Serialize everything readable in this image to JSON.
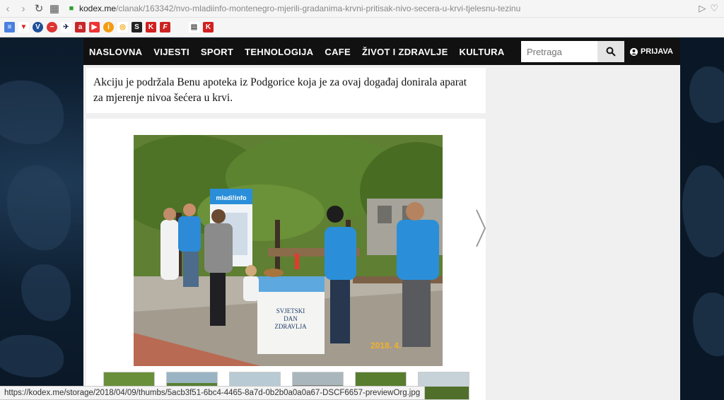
{
  "browser": {
    "url_host": "kodex.me",
    "url_path": "/clanak/163342/nvo-mladiinfo-montenegro-mjerili-gradanima-krvni-pritisak-nivo-secera-u-krvi-tjelesnu-tezinu",
    "status_url": "https://kodex.me/storage/2018/04/09/thumbs/5acb3f51-6bc4-4465-8a7d-0b2b0a0a0a67-DSCF6657-previewOrg.jpg"
  },
  "nav": {
    "items": [
      "NASLOVNA",
      "VIJESTI",
      "SPORT",
      "TEHNOLOGIJA",
      "CAFE",
      "ŽIVOT I ZDRAVLJE",
      "KULTURA"
    ],
    "search_placeholder": "Pretraga",
    "login_label": "PRIJAVA"
  },
  "article": {
    "paragraph": "Akciju je podržala Benu apoteka iz Podgorice koja je za ovaj događaj donirala aparat za mjerenje nivoa šećera u krvi."
  },
  "photo": {
    "date_stamp": "2018. 4.",
    "banner_text": "mladi!info",
    "booth_text_1": "SVJETSKI",
    "booth_text_2": "DAN",
    "booth_text_3": "ZDRAVLJA"
  },
  "colors": {
    "nav_bg": "#111111",
    "accent_blue": "#2a8fd8"
  }
}
